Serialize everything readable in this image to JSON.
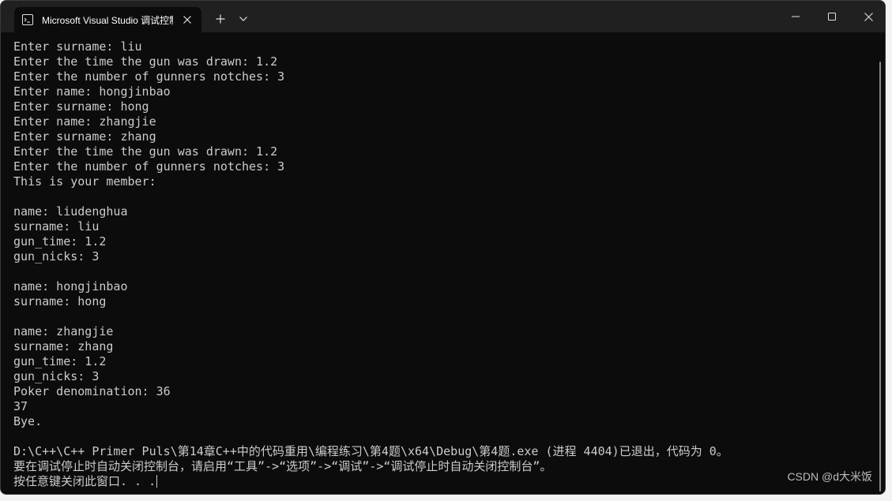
{
  "window": {
    "tab_title": "Microsoft Visual Studio 调试控制台",
    "icons": {
      "tab": "terminal-icon",
      "close_tab": "close-icon",
      "new_tab": "plus-icon",
      "dropdown": "chevron-down-icon",
      "minimize": "minimize-icon",
      "maximize": "maximize-icon",
      "close_window": "close-icon"
    }
  },
  "console": {
    "lines": [
      "Enter surname: liu",
      "Enter the time the gun was drawn: 1.2",
      "Enter the number of gunners notches: 3",
      "Enter name: hongjinbao",
      "Enter surname: hong",
      "Enter name: zhangjie",
      "Enter surname: zhang",
      "Enter the time the gun was drawn: 1.2",
      "Enter the number of gunners notches: 3",
      "This is your member:",
      "",
      "name: liudenghua",
      "surname: liu",
      "gun_time: 1.2",
      "gun_nicks: 3",
      "",
      "name: hongjinbao",
      "surname: hong",
      "",
      "name: zhangjie",
      "surname: zhang",
      "gun_time: 1.2",
      "gun_nicks: 3",
      "Poker denomination: 36",
      "37",
      "Bye.",
      "",
      "D:\\C++\\C++ Primer Puls\\第14章C++中的代码重用\\编程练习\\第4题\\x64\\Debug\\第4题.exe (进程 4404)已退出，代码为 0。",
      "要在调试停止时自动关闭控制台，请启用“工具”->“选项”->“调试”->“调试停止时自动关闭控制台”。",
      "按任意键关闭此窗口. . ."
    ],
    "text_color": "#cccccc",
    "background": "#0c0c0c"
  },
  "watermark": "CSDN @d大米饭"
}
